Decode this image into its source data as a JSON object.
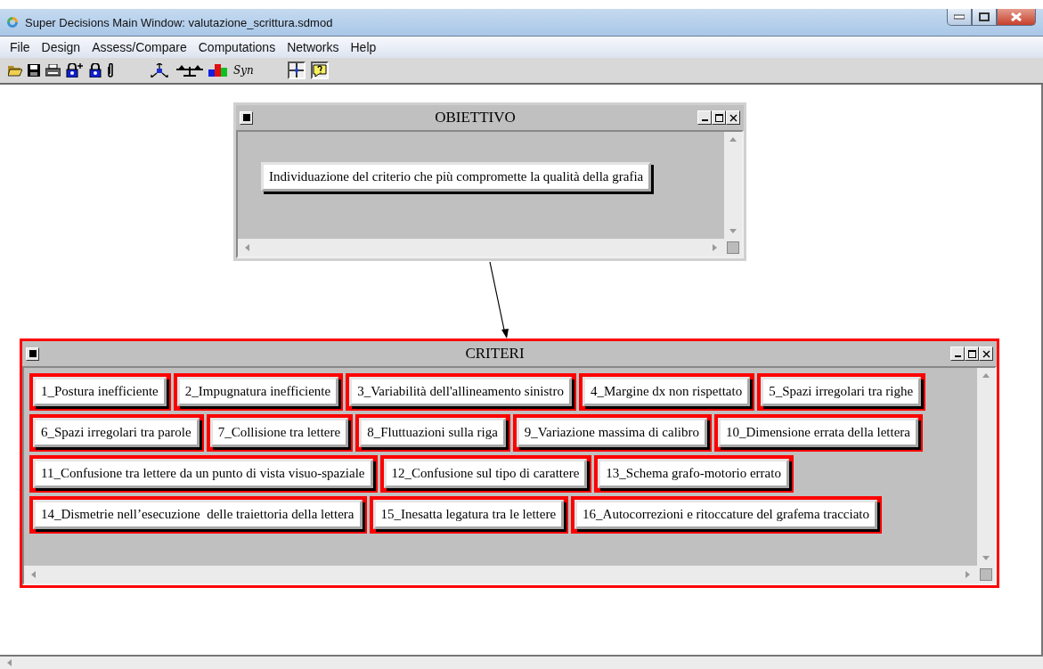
{
  "window": {
    "title": "Super Decisions Main Window: valutazione_scrittura.sdmod"
  },
  "menu": [
    "File",
    "Design",
    "Assess/Compare",
    "Computations",
    "Networks",
    "Help"
  ],
  "toolbar": {
    "syn_label": "Syn",
    "toggles": [
      {
        "pressed": true
      },
      {
        "pressed": true
      }
    ]
  },
  "clusters": [
    {
      "title": "OBIETTIVO",
      "highlighted": false,
      "rows": [
        [
          {
            "label": "Individuazione del criterio che più compromette la qualità della grafia",
            "highlighted": false
          }
        ]
      ]
    },
    {
      "title": "CRITERI",
      "highlighted": true,
      "rows": [
        [
          {
            "label": "1_Postura inefficiente",
            "highlighted": true
          },
          {
            "label": "2_Impugnatura inefficiente",
            "highlighted": true
          },
          {
            "label": "3_Variabilità dell'allineamento sinistro",
            "highlighted": true
          },
          {
            "label": "4_Margine dx non rispettato",
            "highlighted": true
          },
          {
            "label": "5_Spazi irregolari tra righe",
            "highlighted": true
          }
        ],
        [
          {
            "label": "6_Spazi irregolari tra parole",
            "highlighted": true
          },
          {
            "label": "7_Collisione tra lettere",
            "highlighted": true
          },
          {
            "label": "8_Fluttuazioni sulla riga",
            "highlighted": true
          },
          {
            "label": "9_Variazione massima di calibro",
            "highlighted": true
          },
          {
            "label": "10_Dimensione errata della lettera",
            "highlighted": true
          }
        ],
        [
          {
            "label": "11_Confusione tra lettere da un punto di vista visuo-spaziale",
            "highlighted": true
          },
          {
            "label": "12_Confusione sul tipo di carattere",
            "highlighted": true
          },
          {
            "label": "13_Schema grafo-motorio errato",
            "highlighted": true
          }
        ],
        [
          {
            "label": "14_Dismetrie nell’esecuzione  delle traiettoria della lettera",
            "highlighted": true
          },
          {
            "label": "15_Inesatta legatura tra le lettere",
            "highlighted": true
          },
          {
            "label": "16_Autocorrezioni e ritoccature del grafema tracciato",
            "highlighted": true
          }
        ]
      ]
    }
  ]
}
